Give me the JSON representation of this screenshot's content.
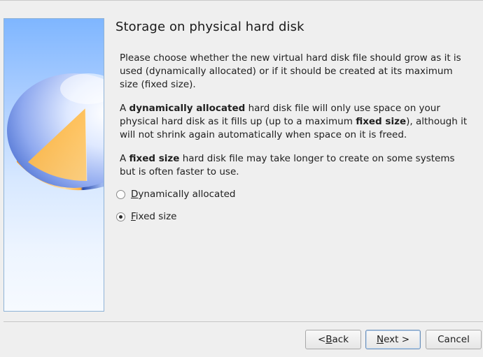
{
  "wizard": {
    "title": "Storage on physical hard disk",
    "paragraphs": {
      "p1": "Please choose whether the new virtual hard disk file should grow as it is used (dynamically allocated) or if it should be created at its maximum size (fixed size).",
      "p2_before": "A ",
      "p2_bold1": "dynamically allocated",
      "p2_mid": " hard disk file will only use space on your physical hard disk as it fills up (up to a maximum ",
      "p2_bold2": "fixed size",
      "p2_after": "), although it will not shrink again automatically when space on it is freed.",
      "p3_before": "A ",
      "p3_bold": "fixed size",
      "p3_after": " hard disk file may take longer to create on some systems but is often faster to use."
    },
    "options": [
      {
        "mnemonic": "D",
        "rest": "ynamically allocated",
        "selected": false
      },
      {
        "mnemonic": "F",
        "rest": "ixed size",
        "selected": true
      }
    ]
  },
  "buttons": {
    "back_prefix": "< ",
    "back_mnemonic": "B",
    "back_rest": "ack",
    "next_mnemonic": "N",
    "next_rest": "ext >",
    "cancel": "Cancel"
  },
  "colors": {
    "panel_sky": "#7fb6ff",
    "disk_orange": "#ffa826",
    "disk_blue": "#3d66c4"
  }
}
